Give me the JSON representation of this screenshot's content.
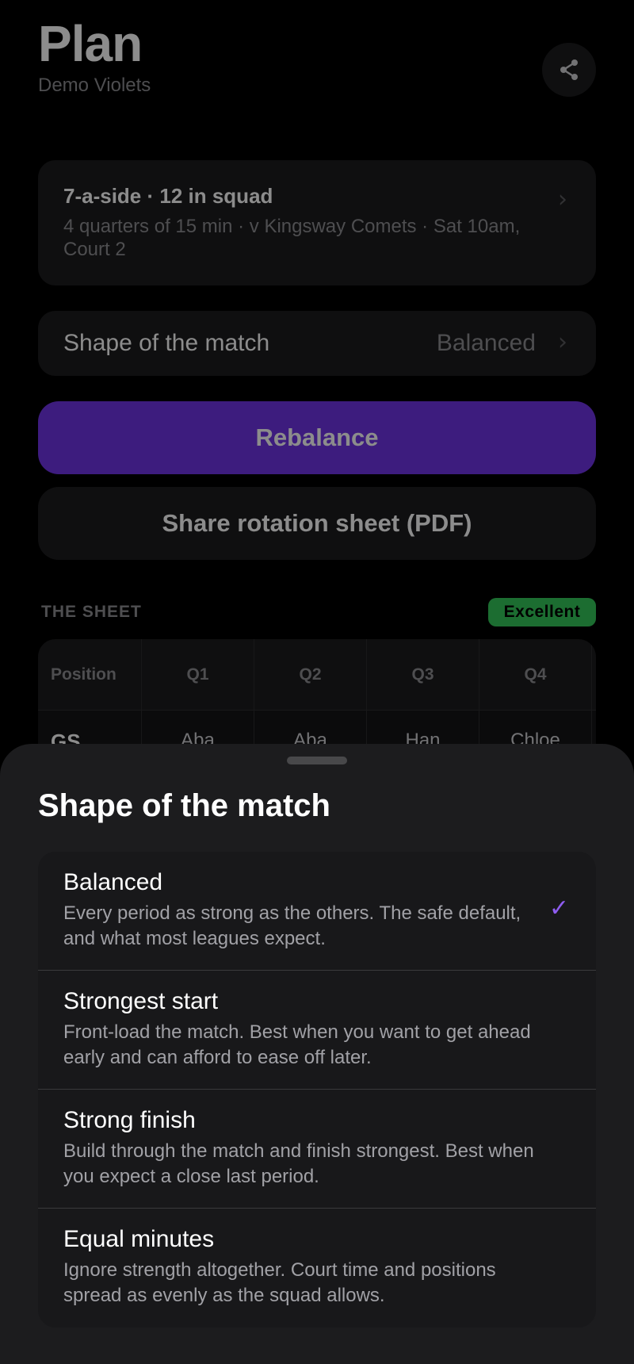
{
  "header": {
    "title": "Plan",
    "subtitle": "Demo Violets",
    "share_icon": "share-icon"
  },
  "summary": {
    "title": "7-a-side · 12 in squad",
    "detail": "4 quarters of 15 min · v Kingsway Comets · Sat 10am, Court 2"
  },
  "shape_row": {
    "label": "Shape of the match",
    "value": "Balanced"
  },
  "buttons": {
    "rebalance": "Rebalance",
    "share_pdf": "Share rotation sheet (PDF)"
  },
  "sheet_section": {
    "label": "THE SHEET",
    "badge": "Excellent",
    "badge_color": "#34c759"
  },
  "table": {
    "headers": [
      "Position",
      "Q1",
      "Q2",
      "Q3",
      "Q4"
    ],
    "rows": [
      [
        "GS",
        "Aba",
        "Aba",
        "Han",
        "Chloe"
      ]
    ]
  },
  "bottom_sheet": {
    "title": "Shape of the match",
    "options": [
      {
        "title": "Balanced",
        "desc": "Every period as strong as the others. The safe default, and what most leagues expect.",
        "selected": true
      },
      {
        "title": "Strongest start",
        "desc": "Front-load the match. Best when you want to get ahead early and can afford to ease off later.",
        "selected": false
      },
      {
        "title": "Strong finish",
        "desc": "Build through the match and finish strongest. Best when you expect a close last period.",
        "selected": false
      },
      {
        "title": "Equal minutes",
        "desc": "Ignore strength altogether. Court time and positions spread as evenly as the squad allows.",
        "selected": false
      }
    ],
    "check_glyph": "✓"
  },
  "colors": {
    "accent": "#6f33e6",
    "check": "#8e5cf0",
    "background": "#000000",
    "card": "#1c1c1e"
  }
}
